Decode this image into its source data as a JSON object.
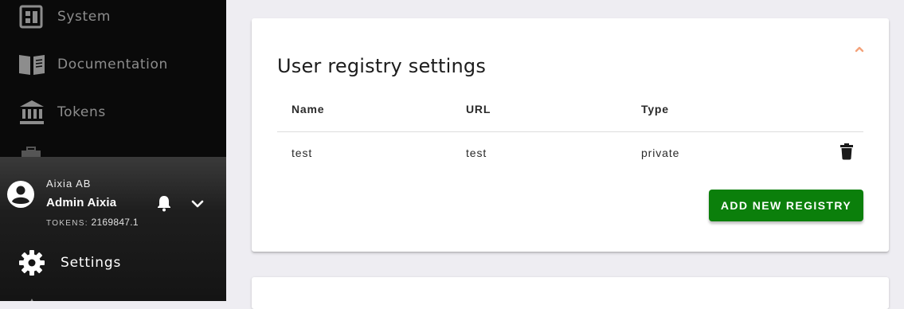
{
  "sidebar": {
    "nav": [
      {
        "label": "System",
        "icon": "dashboard-icon"
      },
      {
        "label": "Documentation",
        "icon": "book-icon"
      },
      {
        "label": "Tokens",
        "icon": "bank-icon"
      }
    ],
    "user": {
      "org": "Aixia AB",
      "name": "Admin Aixia",
      "tokens_label": "TOKENS:",
      "tokens_value": "2169847.1"
    },
    "settings_label": "Settings"
  },
  "card": {
    "title": "User registry settings",
    "accent_color": "#f4a27a",
    "columns": [
      "Name",
      "URL",
      "Type"
    ],
    "rows": [
      {
        "name": "test",
        "url": "test",
        "type": "private"
      }
    ],
    "add_button_label": "ADD NEW REGISTRY",
    "add_button_color": "#0b7f0b"
  }
}
